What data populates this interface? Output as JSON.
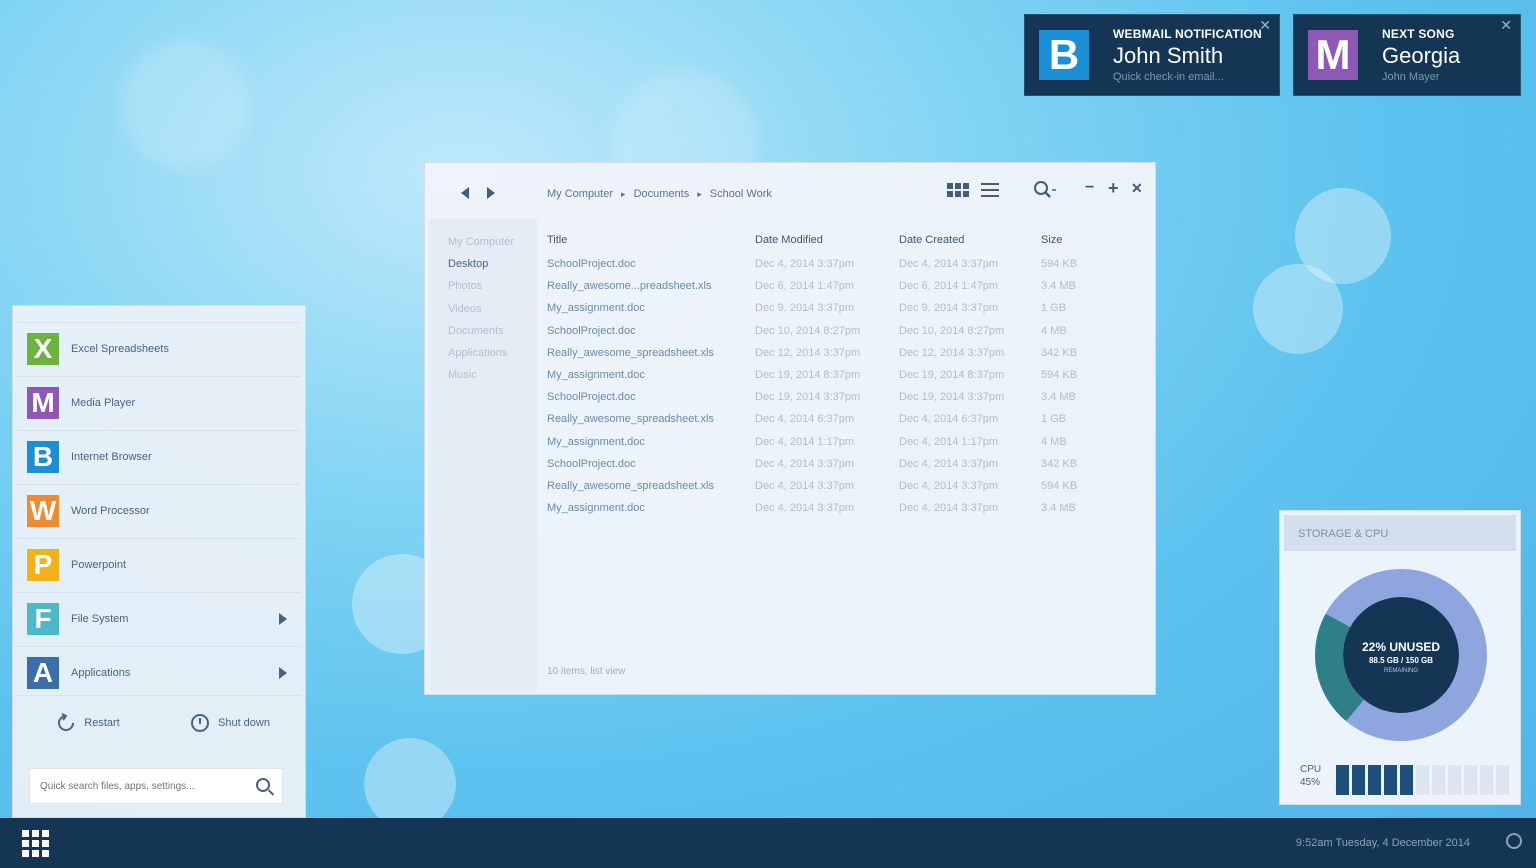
{
  "notifications": [
    {
      "kicker": "WEBMAIL NOTIFICATION",
      "title": "John Smith",
      "sub": "Quick check-in email...",
      "logo": "B",
      "logo_color": "#1b8fd6",
      "close": "✕"
    },
    {
      "kicker": "NEXT SONG",
      "title": "Georgia",
      "sub": "John Mayer",
      "logo": "M",
      "logo_color": "#8e58b5",
      "close": "✕"
    }
  ],
  "window": {
    "breadcrumb": [
      "My Computer",
      "Documents",
      "School Work"
    ],
    "breadcrumb_sep": "▸",
    "icons": {
      "grid": "grid-view-icon",
      "list": "list-view-icon",
      "search": "search-icon",
      "minimize": "−",
      "maximize": "+",
      "close": "✕"
    },
    "sidebar": [
      "My Computer",
      "Desktop",
      "Photos",
      "Videos",
      "Documents",
      "Applications",
      "Music"
    ],
    "columns": [
      "Title",
      "Date Modified",
      "Date Created",
      "Size"
    ],
    "rows": [
      [
        "SchoolProject.doc",
        "Dec 4, 2014 3:37pm",
        "Dec 4, 2014 3:37pm",
        "594 KB"
      ],
      [
        "Really_awesome...preadsheet.xls",
        "Dec 6, 2014 1:47pm",
        "Dec 6, 2014 1:47pm",
        "3.4 MB"
      ],
      [
        "My_assignment.doc",
        "Dec 9, 2014 3:37pm",
        "Dec 9, 2014 3:37pm",
        "1 GB"
      ],
      [
        "SchoolProject.doc",
        "Dec 10, 2014 8:27pm",
        "Dec 10, 2014 8:27pm",
        "4 MB"
      ],
      [
        "Really_awesome_spreadsheet.xls",
        "Dec 12, 2014 3:37pm",
        "Dec 12, 2014 3:37pm",
        "342 KB"
      ],
      [
        "My_assignment.doc",
        "Dec 19, 2014 8:37pm",
        "Dec 19, 2014 8:37pm",
        "594 KB"
      ],
      [
        "SchoolProject.doc",
        "Dec 19, 2014 3:37pm",
        "Dec 19, 2014 3:37pm",
        "3.4 MB"
      ],
      [
        "Really_awesome_spreadsheet.xls",
        "Dec 4, 2014 6:37pm",
        "Dec 4, 2014 6:37pm",
        "1 GB"
      ],
      [
        "My_assignment.doc",
        "Dec 4, 2014 1:17pm",
        "Dec 4, 2014 1:17pm",
        "4 MB"
      ],
      [
        "SchoolProject.doc",
        "Dec 4, 2014 3:37pm",
        "Dec 4, 2014 3:37pm",
        "342 KB"
      ],
      [
        "Really_awesome_spreadsheet.xls",
        "Dec 4, 2014 3:37pm",
        "Dec 4, 2014 3:37pm",
        "594 KB"
      ],
      [
        "My_assignment.doc",
        "Dec 4, 2014 3:37pm",
        "Dec 4, 2014 3:37pm",
        "3.4 MB"
      ]
    ],
    "status": "10 items, list view"
  },
  "start_menu": {
    "apps": [
      {
        "label": "Excel Spreadsheets",
        "letter": "X",
        "color": "#6fb33f",
        "submenu": false
      },
      {
        "label": "Media Player",
        "letter": "M",
        "color": "#8e58b5",
        "submenu": false
      },
      {
        "label": "Internet Browser",
        "letter": "B",
        "color": "#1b8fd6",
        "submenu": false
      },
      {
        "label": "Word Processor",
        "letter": "W",
        "color": "#f08a30",
        "submenu": false
      },
      {
        "label": "Powerpoint",
        "letter": "P",
        "color": "#f3b21a",
        "submenu": false
      },
      {
        "label": "File System",
        "letter": "F",
        "color": "#4fb8c8",
        "submenu": true
      },
      {
        "label": "Applications",
        "letter": "A",
        "color": "#3a6fa8",
        "submenu": true
      }
    ],
    "restart": "Restart",
    "shutdown": "Shut down",
    "search_placeholder": "Quick search files, apps, settings..."
  },
  "storage": {
    "title": "STORAGE & CPU",
    "unused_label": "22% UNUSED",
    "detail": "88.5 GB / 150 GB",
    "remaining": "REMAINING",
    "unused_fraction": 0.22,
    "cpu_label": "CPU",
    "cpu_value": "45%",
    "cpu_fraction": 0.45,
    "cpu_bars_total": 11,
    "colors": {
      "used": "#8ea6dd",
      "unused": "#2f7f86",
      "center": "#143654"
    }
  },
  "taskbar": {
    "clock": "9:52am Tuesday, 4 December 2014"
  }
}
